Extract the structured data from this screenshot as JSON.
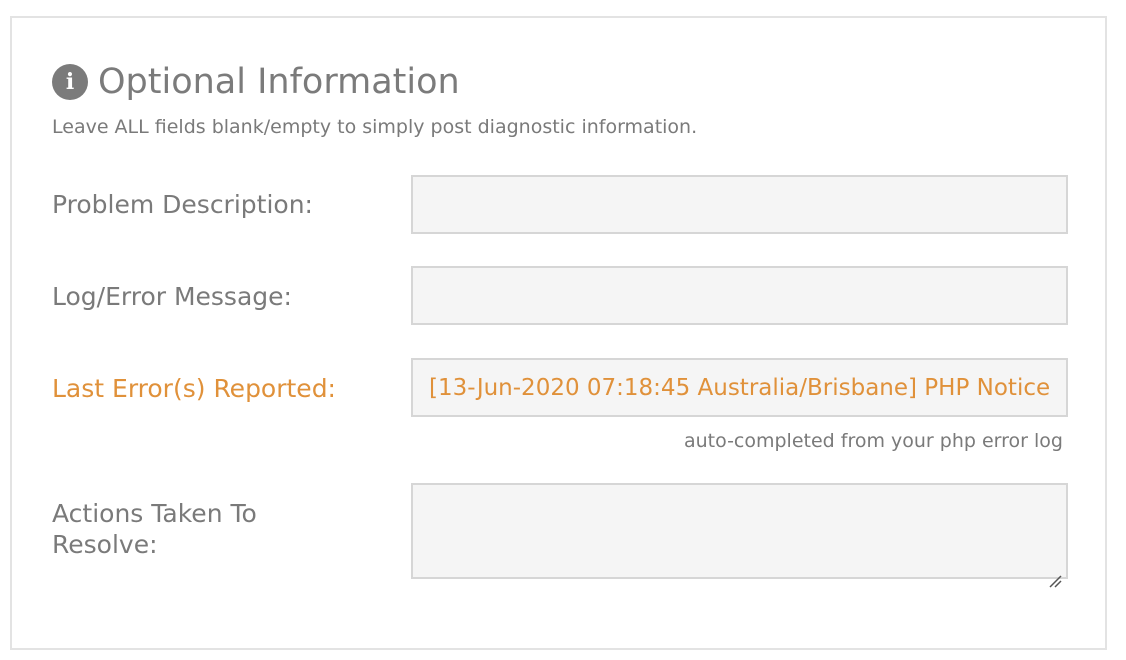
{
  "section": {
    "title": "Optional Information",
    "subtitle": "Leave ALL fields blank/empty to simply post diagnostic information.",
    "icon": "info-icon"
  },
  "fields": {
    "problem_description": {
      "label": "Problem Description:",
      "value": ""
    },
    "log_error_message": {
      "label": "Log/Error Message:",
      "value": ""
    },
    "last_errors_reported": {
      "label": "Last Error(s) Reported:",
      "value": "[13-Jun-2020 07:18:45 Australia/Brisbane] PHP Notice",
      "hint": "auto-completed from your php error log"
    },
    "actions_taken": {
      "label_line1": "Actions Taken To",
      "label_line2": "Resolve:",
      "value": ""
    }
  },
  "colors": {
    "label_gray": "#7a7a7a",
    "accent_orange": "#e0913a",
    "field_bg": "#f5f5f5",
    "field_border": "#d6d6d6"
  }
}
